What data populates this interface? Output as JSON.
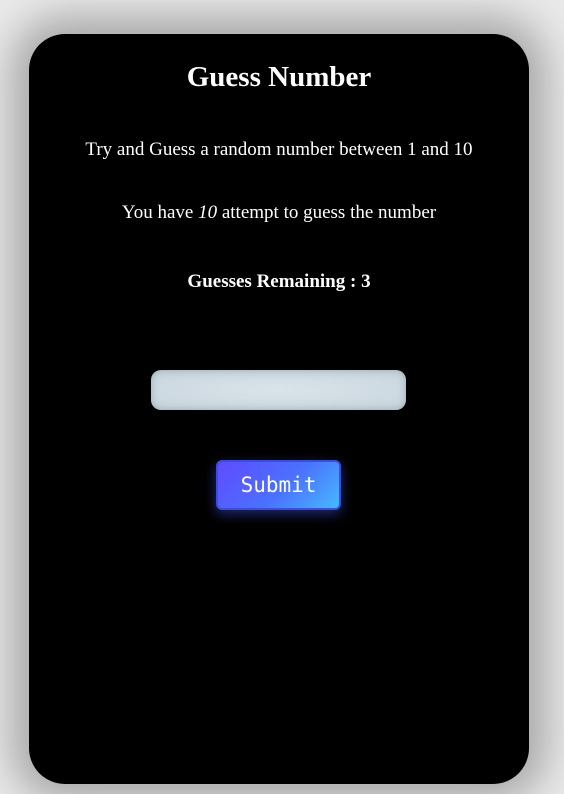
{
  "game": {
    "title": "Guess Number",
    "intro": "Try and Guess a random number between 1 and 10",
    "attempts_prefix": "You have ",
    "attempts_count": "10",
    "attempts_suffix": " attempt to guess the number",
    "remaining_label": "Guesses Remaining : ",
    "remaining_value": "3",
    "input_value": "",
    "input_placeholder": "",
    "submit_label": "Submit"
  },
  "colors": {
    "card_background": "#000000",
    "page_background": "#e9e9e9",
    "text": "#ffffff",
    "button_gradient_start": "#5f4bff",
    "button_gradient_end": "#47b8ff",
    "input_background": "#d0dce2"
  }
}
